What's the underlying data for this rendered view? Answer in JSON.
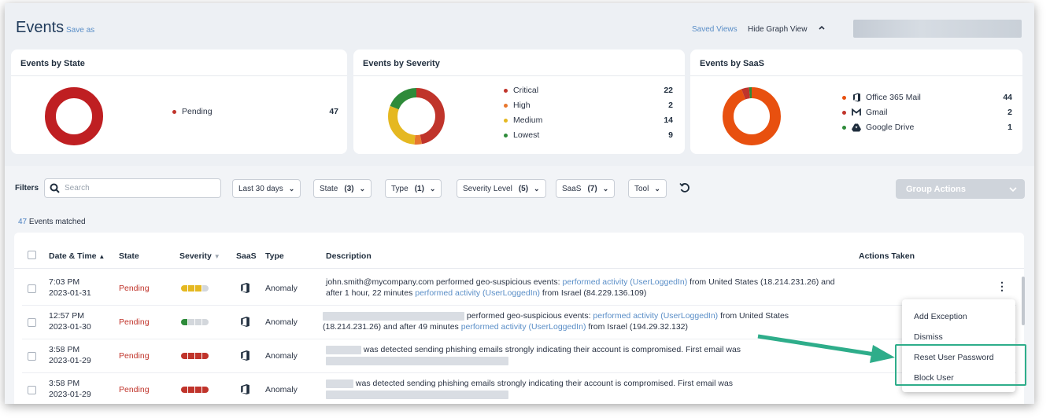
{
  "header": {
    "title": "Events",
    "save_as": "Save as",
    "saved_views": "Saved Views",
    "hide_graph": "Hide Graph View"
  },
  "cards": {
    "state": {
      "title": "Events by State",
      "legend": [
        {
          "label": "Pending",
          "value": "47",
          "color": "#c0342b"
        }
      ]
    },
    "severity": {
      "title": "Events by Severity",
      "legend": [
        {
          "label": "Critical",
          "value": "22",
          "color": "#c0342b"
        },
        {
          "label": "High",
          "value": "2",
          "color": "#e8772e"
        },
        {
          "label": "Medium",
          "value": "14",
          "color": "#e5b821"
        },
        {
          "label": "Lowest",
          "value": "9",
          "color": "#2e8b3a"
        }
      ]
    },
    "saas": {
      "title": "Events by SaaS",
      "legend": [
        {
          "label": "Office 365 Mail",
          "value": "44",
          "color": "#e8500f",
          "icon": "office-icon"
        },
        {
          "label": "Gmail",
          "value": "2",
          "color": "#c0342b",
          "icon": "gmail-icon"
        },
        {
          "label": "Google Drive",
          "value": "1",
          "color": "#2e8b3a",
          "icon": "google-drive-icon"
        }
      ]
    }
  },
  "filters": {
    "label": "Filters",
    "search_placeholder": "Search",
    "date_range": "Last 30 days",
    "state": {
      "label": "State",
      "count": "(3)"
    },
    "type": {
      "label": "Type",
      "count": "(1)"
    },
    "severity": {
      "label": "Severity Level",
      "count": "(5)"
    },
    "saas": {
      "label": "SaaS",
      "count": "(7)"
    },
    "tool": {
      "label": "Tool"
    },
    "group_actions": "Group Actions"
  },
  "table": {
    "matched_count": "47",
    "matched_label": "Events matched",
    "headers": {
      "datetime": "Date & Time",
      "state": "State",
      "severity": "Severity",
      "saas": "SaaS",
      "type": "Type",
      "description": "Description",
      "actions": "Actions Taken"
    },
    "rows": [
      {
        "time": "7:03 PM",
        "date": "2023-01-31",
        "state": "Pending",
        "type": "Anomaly",
        "severity_level": 3,
        "d1": "john.smith@mycompany.com performed geo-suspicious events: ",
        "d2": "performed activity (UserLoggedIn)",
        "d3": " from United States (18.214.231.26) and",
        "d4": "after 1 hour, 22 minutes ",
        "d5": "performed activity (UserLoggedIn)",
        "d6": " from Israel (84.229.136.109)"
      },
      {
        "time": "12:57 PM",
        "date": "2023-01-30",
        "state": "Pending",
        "type": "Anomaly",
        "severity_level": 1,
        "d1": " performed geo-suspicious events: ",
        "d2": "performed activity (UserLoggedIn)",
        "d3": " from United States",
        "d4": "(18.214.231.26) and after 49 minutes ",
        "d5": "performed activity (UserLoggedIn)",
        "d6": " from Israel (194.29.32.132)"
      },
      {
        "time": "3:58 PM",
        "date": "2023-01-29",
        "state": "Pending",
        "type": "Anomaly",
        "severity_level": 4,
        "d1": "was detected sending phishing emails strongly indicating their account is compromised. First email was"
      },
      {
        "time": "3:58 PM",
        "date": "2023-01-29",
        "state": "Pending",
        "type": "Anomaly",
        "severity_level": 4,
        "d1": "was detected sending phishing emails strongly indicating their account is compromised. First email was"
      }
    ]
  },
  "menu": {
    "items": [
      "Add Exception",
      "Dismiss",
      "Reset User Password",
      "Block User"
    ]
  },
  "colors": {
    "accent_link": "#5a8ec7",
    "pending": "#c0342b",
    "highlight": "#2ead8a"
  }
}
